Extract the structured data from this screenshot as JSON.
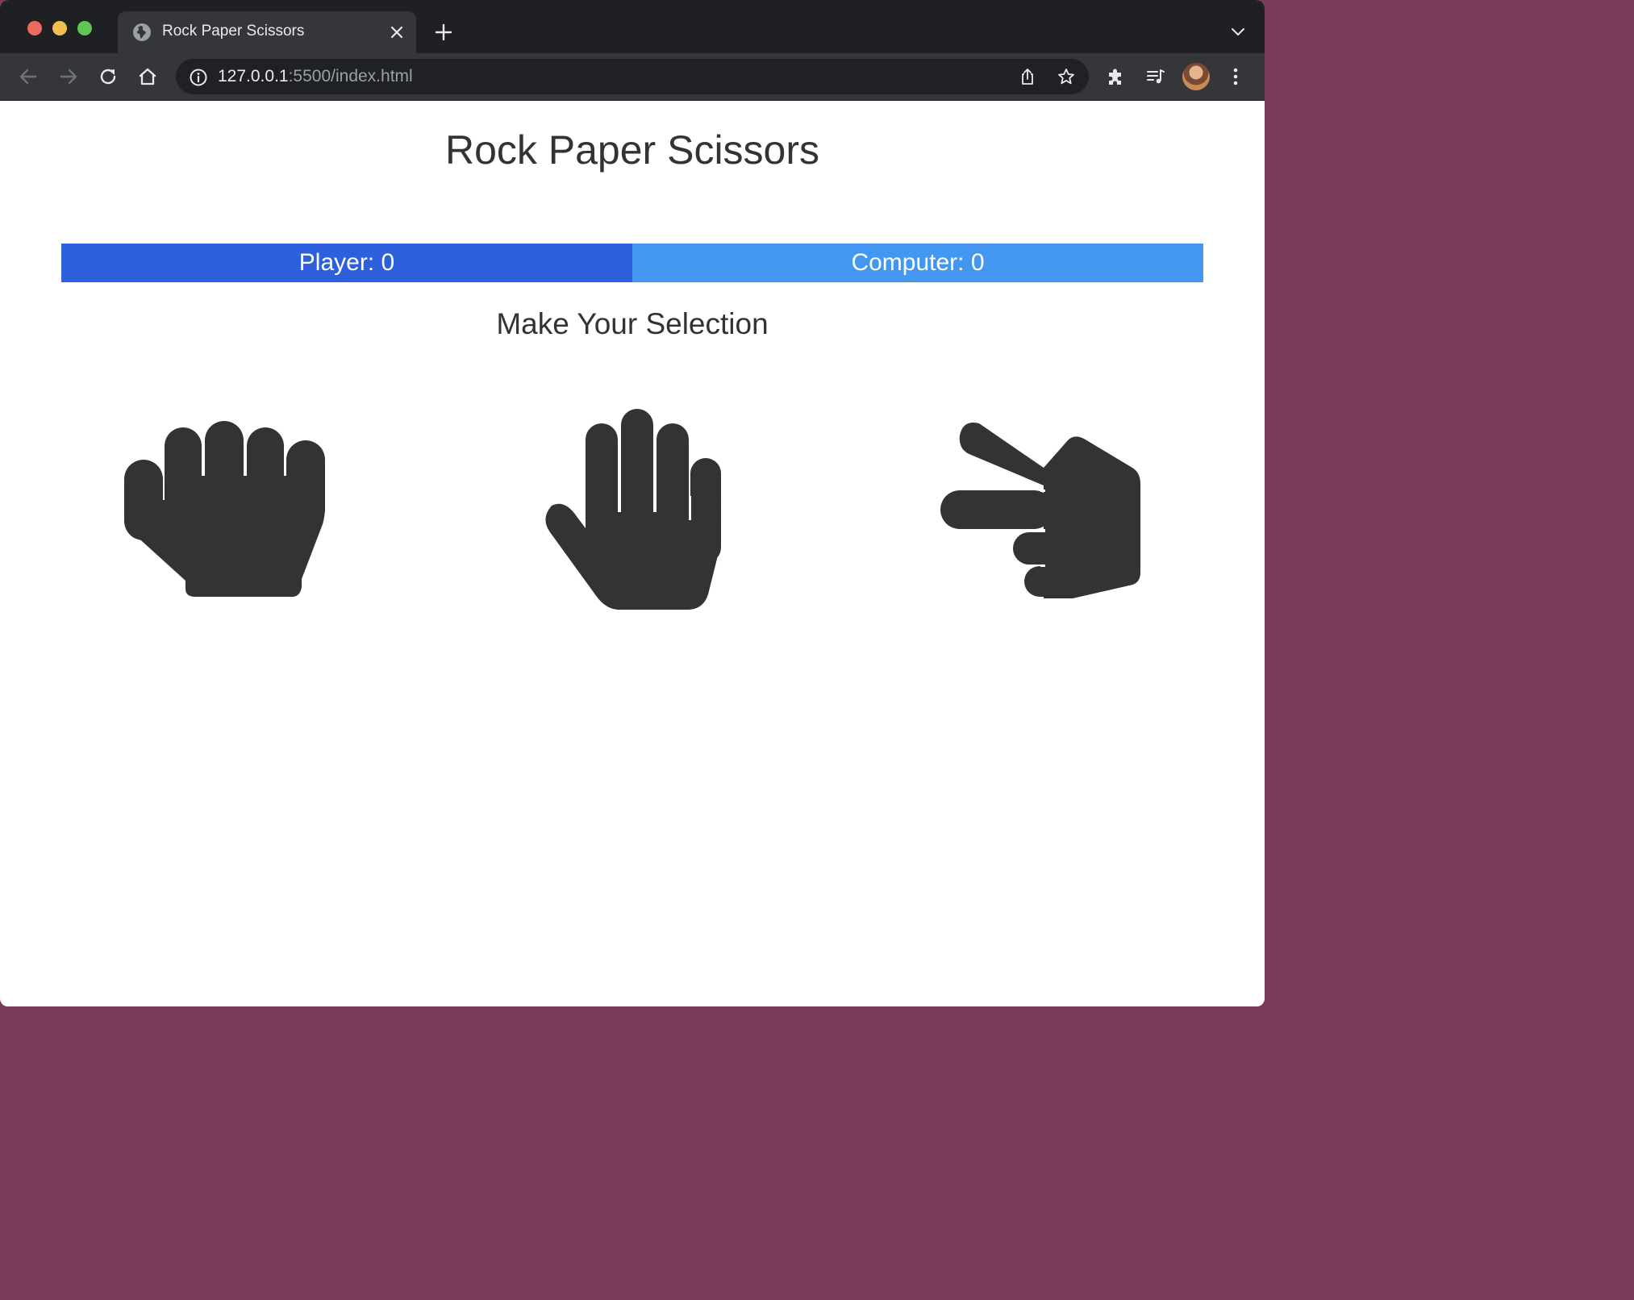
{
  "browser": {
    "tab_title": "Rock Paper Scissors",
    "url_host": "127.0.0.1",
    "url_path": ":5500/index.html"
  },
  "page": {
    "title": "Rock Paper Scissors",
    "player_score_label": "Player: 0",
    "computer_score_label": "Computer: 0",
    "selection_heading": "Make Your Selection",
    "choices": [
      {
        "name": "rock",
        "icon": "fist-icon"
      },
      {
        "name": "paper",
        "icon": "open-hand-icon"
      },
      {
        "name": "scissors",
        "icon": "peace-hand-icon"
      }
    ],
    "colors": {
      "player_bar": "#2c60dd",
      "computer_bar": "#4497f1",
      "text": "#333333"
    }
  }
}
